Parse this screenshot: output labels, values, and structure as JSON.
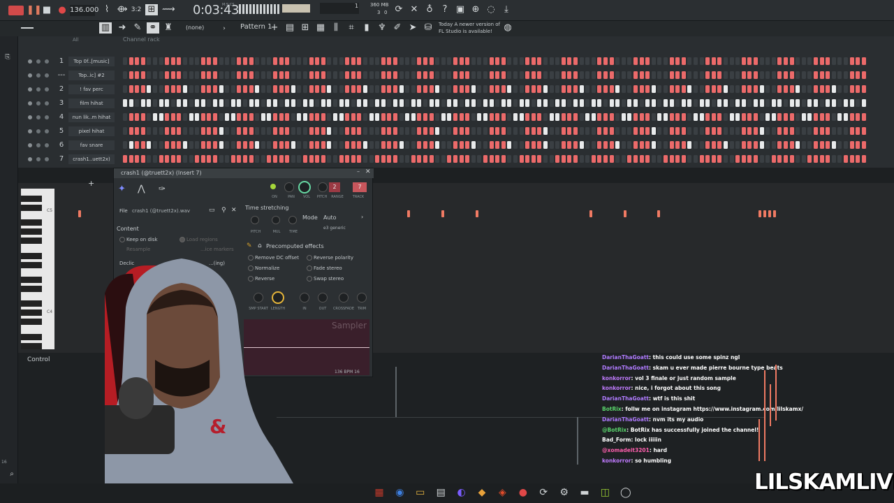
{
  "toolbar": {
    "tempo": "136.000",
    "time_label": "M:S:CS",
    "time": "0:03:43",
    "counter": "1",
    "memory": "360 MB",
    "mem_sub": "3",
    "cpu_sub": "0"
  },
  "toolbar2": {
    "preset": "(none)",
    "pattern": "Pattern 1",
    "hint_line1": "Today  A newer version of",
    "hint_line2": "FL Studio is available!"
  },
  "rack": {
    "filter": "All",
    "title": "Channel rack",
    "rows": [
      {
        "num": "1",
        "name": "Top 0f..[music]"
      },
      {
        "num": "---",
        "name": "Top..ic] #2"
      },
      {
        "num": "2",
        "name": "! fav perc"
      },
      {
        "num": "3",
        "name": "film hihat"
      },
      {
        "num": "4",
        "name": "nun lik..m hihat"
      },
      {
        "num": "5",
        "name": "pixel hihat"
      },
      {
        "num": "6",
        "name": "fav snare"
      },
      {
        "num": "7",
        "name": "crash1..uett2x)"
      }
    ]
  },
  "sampler": {
    "title": "crash1 (@truett2x) (Insert 7)",
    "file_label": "File",
    "file_name": "crash1 (@truett2x).wav",
    "knobs": [
      "ON",
      "PAN",
      "VOL",
      "PITCH",
      "RANGE",
      "TRACK"
    ],
    "range_val": "2",
    "track_val": "7",
    "time_stretching": "Time stretching",
    "mode_label": "Mode",
    "mode_value": "Auto",
    "mode_sub": "e3 generic",
    "ts_knobs": [
      "PITCH",
      "MUL",
      "TIME"
    ],
    "content": "Content",
    "keep_on_disk": "Keep on disk",
    "load_regions": "Load regions",
    "resample": "Resample",
    "slice_markers": "...ice markers",
    "declick": "Declic",
    "declick_val": "...(ing)",
    "precomputed": "Precomputed effects",
    "fx": [
      "Remove DC offset",
      "Reverse polarity",
      "Normalize",
      "Fade stereo",
      "Reverse",
      "Swap stereo"
    ],
    "bottom_knobs": [
      "SMP START",
      "LENGTH",
      "IN",
      "OUT",
      "CROSSFADE",
      "TRIM"
    ],
    "wave_label": "Sampler",
    "footer": "136 BPM 16"
  },
  "piano": {
    "c5": "C5",
    "c4": "C4"
  },
  "control_label": "Control",
  "left_bottom": "16",
  "chat": [
    {
      "user": "DarianThaGoatt",
      "color": "#b07bff",
      "msg": ": this could use some spinz ngl"
    },
    {
      "user": "DarianThaGoatt",
      "color": "#b07bff",
      "msg": ": skam u ever made pierre bourne type beats"
    },
    {
      "user": "konkorror",
      "color": "#c07bff",
      "msg": ": vol 3 finale or just random sample"
    },
    {
      "user": "konkorror",
      "color": "#c07bff",
      "msg": ": nice, i forgot about this song"
    },
    {
      "user": "DarianThaGoatt",
      "color": "#b07bff",
      "msg": ": wtf is this shit"
    },
    {
      "user": "BotRix",
      "color": "#59d26b",
      "msg": ": follw me on instagram https://www.instagram.com/lilskamx/"
    },
    {
      "user": "DarianThaGoatt",
      "color": "#b07bff",
      "msg": ": nvm its my audio"
    },
    {
      "user": "@BotRix",
      "color": "#59d26b",
      "msg": ": BotRix has successfully joined the channel!"
    },
    {
      "user": "Bad_Form",
      "color": "#ffffff",
      "msg": ": lock iiiiin"
    },
    {
      "user": "@xomadeit3201",
      "color": "#ff5fae",
      "msg": ": hard"
    },
    {
      "user": "konkorror",
      "color": "#c07bff",
      "msg": ": so humbling"
    }
  ],
  "brand": "LILSKAMLIVE",
  "taskbar_icons": [
    "us-flag-icon",
    "firefox-icon",
    "folder-icon",
    "store-icon",
    "discord-icon",
    "fl-studio-icon",
    "brave-icon",
    "record-icon",
    "refresh-icon",
    "steam-icon",
    "app-icon",
    "layers-icon",
    "4k-icon"
  ]
}
